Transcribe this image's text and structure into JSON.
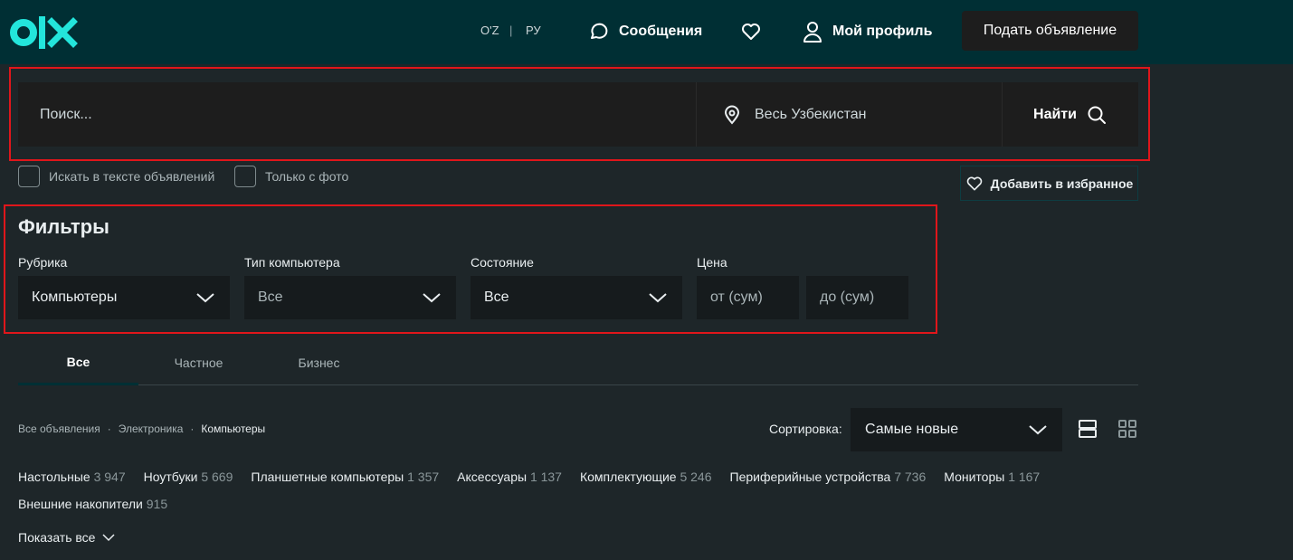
{
  "header": {
    "lang_uz": "O'Z",
    "lang_sep": "|",
    "lang_ru": "РУ",
    "messages": "Сообщения",
    "profile": "Мой профиль",
    "post_ad": "Подать объявление",
    "brand_color": "#002f34"
  },
  "search": {
    "placeholder": "Поиск...",
    "location": "Весь Узбекистан",
    "find": "Найти"
  },
  "options": {
    "search_in_text": "Искать в тексте объявлений",
    "only_with_photo": "Только с фото",
    "add_to_favorites": "Добавить в избранное"
  },
  "filters": {
    "title": "Фильтры",
    "category_label": "Рубрика",
    "category_value": "Компьютеры",
    "computer_type_label": "Тип компьютера",
    "computer_type_value": "Все",
    "condition_label": "Состояние",
    "condition_value": "Все",
    "price_label": "Цена",
    "price_from": "от (сум)",
    "price_to": "до (сум)"
  },
  "tabs": [
    "Все",
    "Частное",
    "Бизнес"
  ],
  "breadcrumb": {
    "items": [
      "Все объявления",
      "Электроника",
      "Компьютеры"
    ],
    "sep": "·"
  },
  "sort": {
    "label": "Сортировка:",
    "value": "Самые новые"
  },
  "categories": [
    {
      "name": "Настольные",
      "count": "3 947"
    },
    {
      "name": "Ноутбуки",
      "count": "5 669"
    },
    {
      "name": "Планшетные компьютеры",
      "count": "1 357"
    },
    {
      "name": "Аксессуары",
      "count": "1 137"
    },
    {
      "name": "Комплектующие",
      "count": "5 246"
    },
    {
      "name": "Периферийные устройства",
      "count": "7 736"
    },
    {
      "name": "Мониторы",
      "count": "1 167"
    },
    {
      "name": "Внешние накопители",
      "count": "915"
    }
  ],
  "show_all": "Показать все"
}
